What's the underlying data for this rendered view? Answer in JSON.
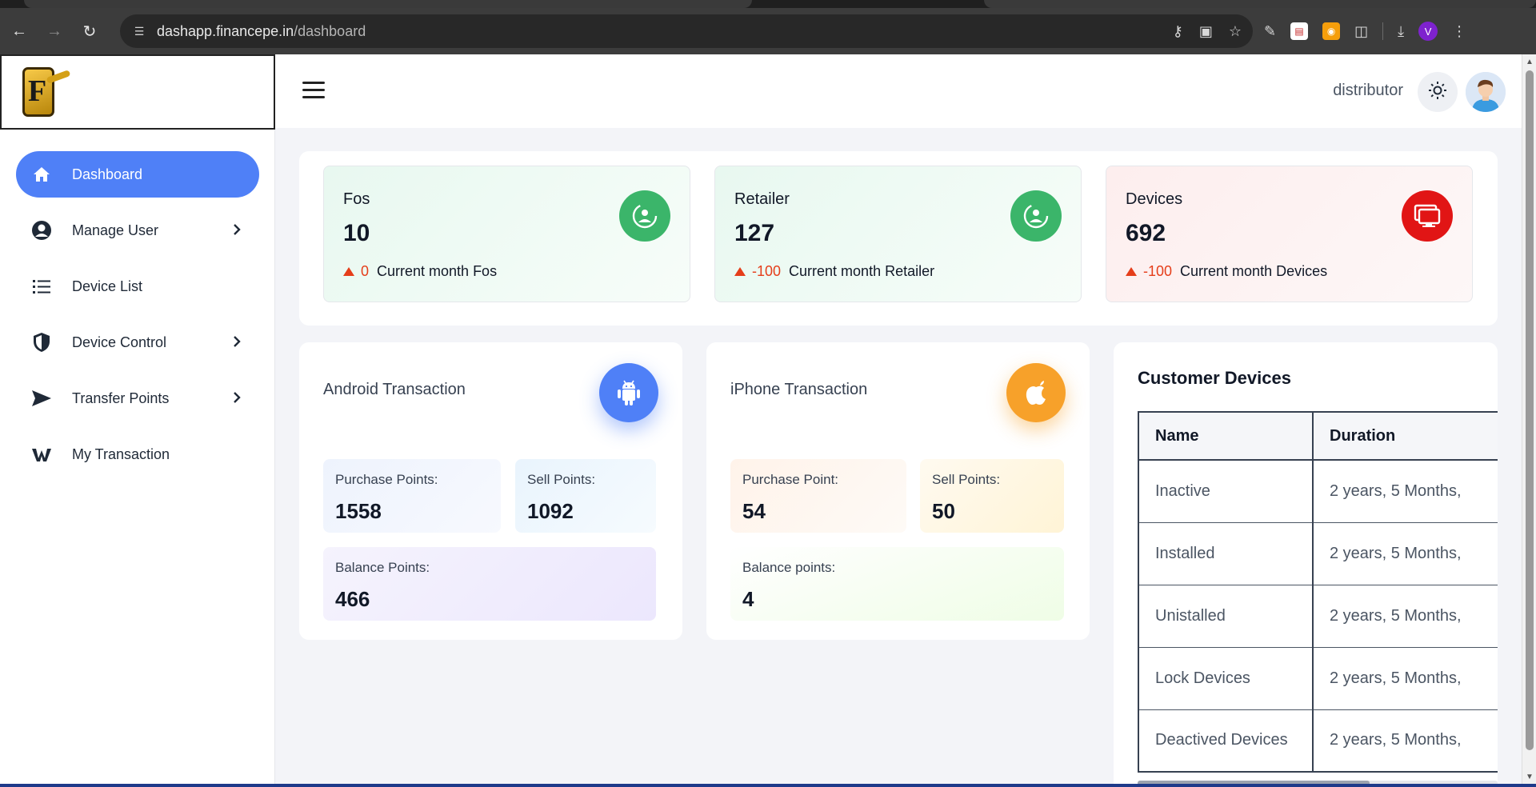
{
  "browser": {
    "url_host": "dashapp.financepe.in",
    "url_path": "/dashboard",
    "profile_initial": "V"
  },
  "sidebar": {
    "items": [
      {
        "label": "Dashboard",
        "icon": "home-icon",
        "active": true
      },
      {
        "label": "Manage User",
        "icon": "user-circle-icon",
        "has_submenu": true
      },
      {
        "label": "Device List",
        "icon": "list-icon"
      },
      {
        "label": "Device Control",
        "icon": "shield-icon",
        "has_submenu": true
      },
      {
        "label": "Transfer Points",
        "icon": "send-icon",
        "has_submenu": true
      },
      {
        "label": "My Transaction",
        "icon": "transaction-icon"
      }
    ]
  },
  "header": {
    "user_role": "distributor"
  },
  "stats": [
    {
      "title": "Fos",
      "value": "10",
      "delta": "0",
      "caption": "Current month Fos",
      "color": "#3bb56a"
    },
    {
      "title": "Retailer",
      "value": "127",
      "delta": "-100",
      "caption": "Current month Retailer",
      "color": "#3bb56a"
    },
    {
      "title": "Devices",
      "value": "692",
      "delta": "-100",
      "caption": "Current month Devices",
      "color": "#e11515"
    }
  ],
  "android": {
    "title": "Android Transaction",
    "purchase_label": "Purchase Points:",
    "purchase_value": "1558",
    "sell_label": "Sell Points:",
    "sell_value": "1092",
    "balance_label": "Balance Points:",
    "balance_value": "466"
  },
  "iphone": {
    "title": "iPhone Transaction",
    "purchase_label": "Purchase Point:",
    "purchase_value": "54",
    "sell_label": "Sell Points:",
    "sell_value": "50",
    "balance_label": "Balance points:",
    "balance_value": "4"
  },
  "customer_devices": {
    "title": "Customer Devices",
    "columns": [
      "Name",
      "Duration"
    ],
    "rows": [
      [
        "Inactive",
        "2 years, 5 Months,"
      ],
      [
        "Installed",
        "2 years, 5 Months,"
      ],
      [
        "Unistalled",
        "2 years, 5 Months,"
      ],
      [
        "Lock Devices",
        "2 years, 5 Months,"
      ],
      [
        "Deactived Devices",
        "2 years, 5 Months,"
      ]
    ]
  }
}
